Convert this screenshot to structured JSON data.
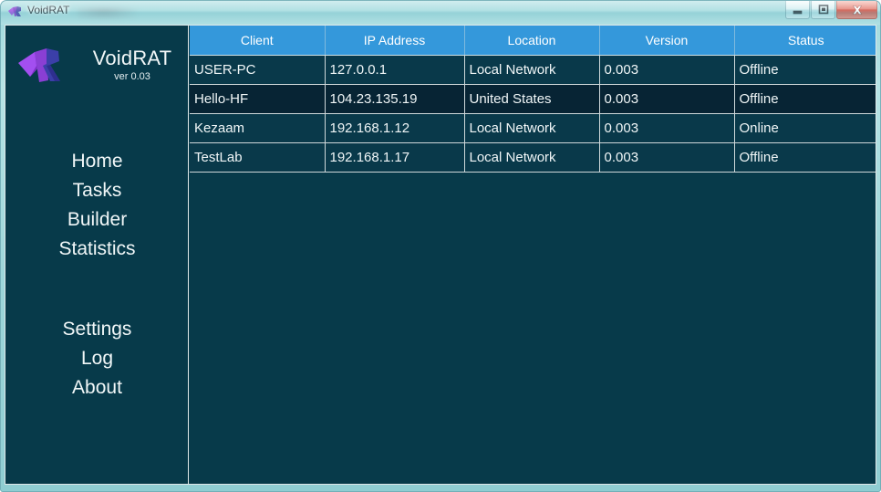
{
  "window": {
    "title": "VoidRAT",
    "icon": "voidrat-logo-icon",
    "redacted_label": "",
    "controls": {
      "minimize": "Minimize",
      "maximize": "Maximize",
      "close": "Close"
    }
  },
  "sidebar": {
    "brand": {
      "name": "VoidRAT",
      "version": "ver 0.03",
      "logo": "voidrat-logo-icon"
    },
    "primary_items": [
      {
        "label": "Home"
      },
      {
        "label": "Tasks"
      },
      {
        "label": "Builder"
      },
      {
        "label": "Statistics"
      }
    ],
    "secondary_items": [
      {
        "label": "Settings"
      },
      {
        "label": "Log"
      },
      {
        "label": "About"
      }
    ]
  },
  "table": {
    "columns": [
      "Client",
      "IP Address",
      "Location",
      "Version",
      "Status"
    ],
    "rows": [
      {
        "client": "USER-PC",
        "ip": "127.0.0.1",
        "location": "Local Network",
        "version": "0.003",
        "status": "Offline"
      },
      {
        "client": "Hello-HF",
        "ip": "104.23.135.19",
        "location": "United States",
        "version": "0.003",
        "status": "Offline"
      },
      {
        "client": "Kezaam",
        "ip": "192.168.1.12",
        "location": "Local Network",
        "version": "0.003",
        "status": "Online"
      },
      {
        "client": "TestLab",
        "ip": "192.168.1.17",
        "location": "Local Network",
        "version": "0.003",
        "status": "Offline"
      }
    ]
  },
  "colors": {
    "header_blue": "#3498db",
    "panel_teal": "#073a4a",
    "row_dark": "#072434",
    "row_light": "#09394a",
    "frame_aqua": "#9fd9dd",
    "close_red": "#c8493c",
    "logo_purple": "#8a3fd4",
    "logo_blue": "#3b3fa8"
  }
}
